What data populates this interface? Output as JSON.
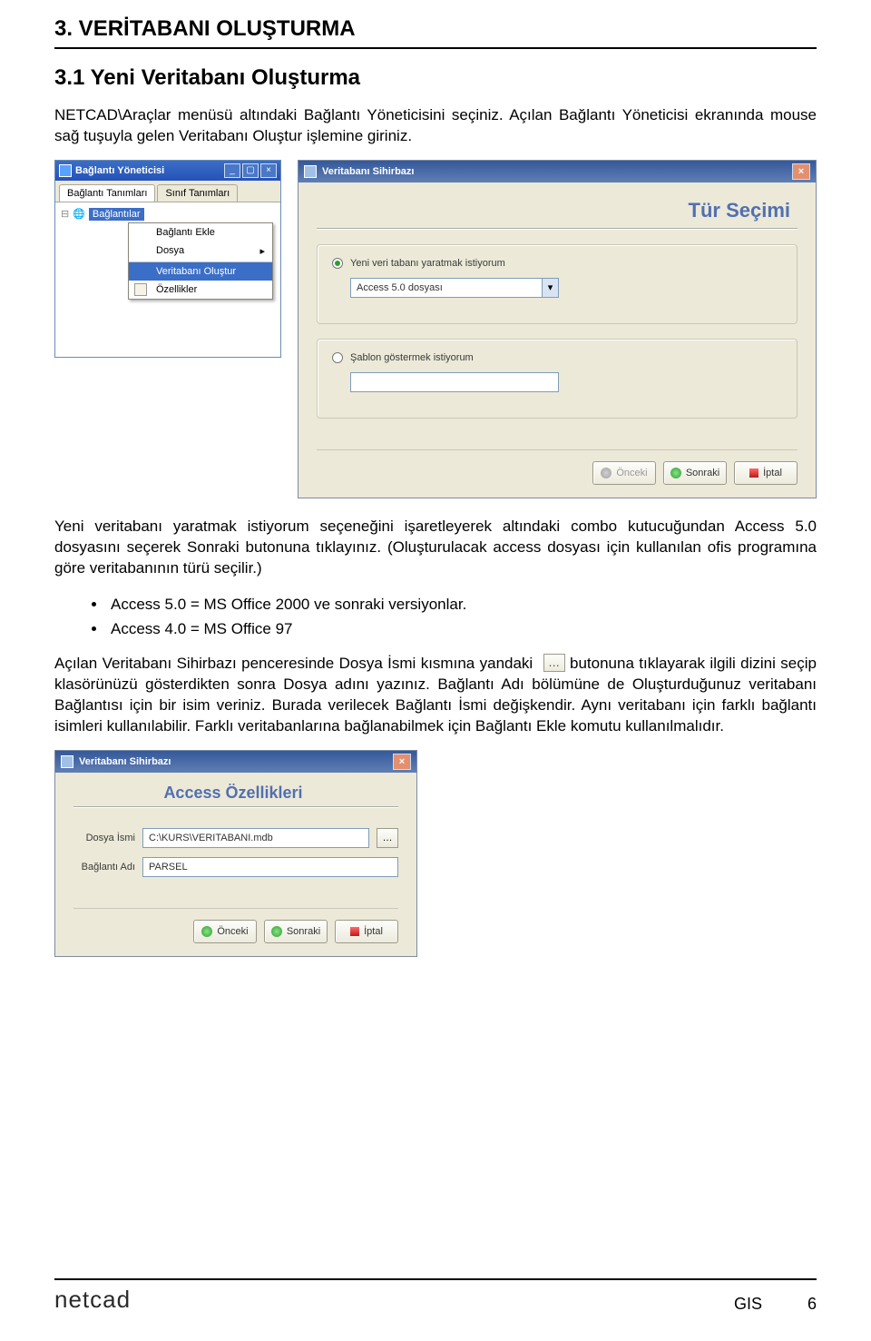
{
  "headings": {
    "h1": "3. VERİTABANI OLUŞTURMA",
    "h2": "3.1 Yeni Veritabanı Oluşturma"
  },
  "paragraphs": {
    "p1": "NETCAD\\Araçlar menüsü altındaki Bağlantı Yöneticisini seçiniz. Açılan Bağlantı Yöneticisi ekranında mouse sağ tuşuyla gelen Veritabanı Oluştur işlemine giriniz.",
    "p2": "Yeni veritabanı yaratmak istiyorum seçeneğini işaretleyerek altındaki combo kutucuğundan Access 5.0 dosyasını seçerek Sonraki butonuna tıklayınız. (Oluşturulacak access dosyası için kullanılan ofis programına göre veritabanının türü seçilir.)",
    "p3a": "Açılan Veritabanı Sihirbazı penceresinde Dosya İsmi kısmına yandaki",
    "p3b": "butonuna tıklayarak ilgili dizini seçip klasörünüzü gösterdikten sonra Dosya adını yazınız. Bağlantı Adı bölümüne de Oluşturduğunuz veritabanı Bağlantısı için bir isim veriniz. Burada verilecek Bağlantı İsmi değişkendir. Aynı veritabanı için farklı bağlantı isimleri kullanılabilir. Farklı veritabanlarına bağlanabilmek için Bağlantı Ekle komutu kullanılmalıdır."
  },
  "bullets": [
    "Access 5.0 = MS Office 2000 ve sonraki versiyonlar.",
    "Access 4.0 = MS Office 97"
  ],
  "window_by": {
    "title": "Bağlantı Yöneticisi",
    "tabs": {
      "t1": "Bağlantı Tanımları",
      "t2": "Sınıf Tanımları"
    },
    "root": "Bağlantılar",
    "menu": {
      "m1": "Bağlantı Ekle",
      "m2": "Dosya",
      "m3": "Veritabanı Oluştur",
      "m4": "Özellikler"
    }
  },
  "wizard1": {
    "title": "Veritabanı Sihirbazı",
    "pane": "Tür Seçimi",
    "opt1": "Yeni veri tabanı yaratmak istiyorum",
    "combo": "Access 5.0 dosyası",
    "opt2": "Şablon göstermek istiyorum",
    "btn_back": "Önceki",
    "btn_next": "Sonraki",
    "btn_cancel": "İptal"
  },
  "wizard2": {
    "title": "Veritabanı Sihirbazı",
    "pane": "Access Özellikleri",
    "f_file_label": "Dosya İsmi",
    "f_file_value": "C:\\KURS\\VERITABANI.mdb",
    "f_conn_label": "Bağlantı Adı",
    "f_conn_value": "PARSEL",
    "btn_back": "Önceki",
    "btn_next": "Sonraki",
    "btn_cancel": "İptal"
  },
  "ellipsis": "…",
  "footer": {
    "brand": "netcad",
    "doc": "GIS",
    "page": "6"
  }
}
